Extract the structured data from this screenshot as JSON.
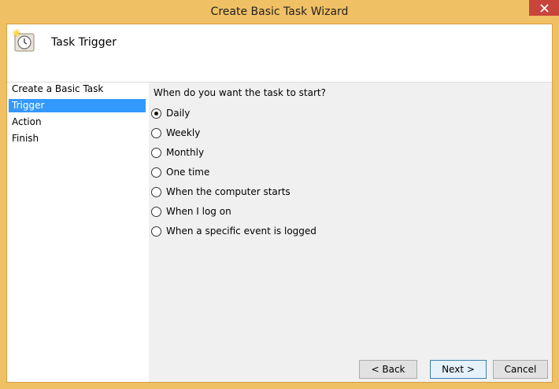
{
  "window": {
    "title": "Create Basic Task Wizard",
    "close_icon": "close-icon"
  },
  "header": {
    "icon": "clock-icon",
    "title": "Task Trigger"
  },
  "sidebar": {
    "items": [
      {
        "label": "Create a Basic Task",
        "selected": false
      },
      {
        "label": "Trigger",
        "selected": true
      },
      {
        "label": "Action",
        "selected": false
      },
      {
        "label": "Finish",
        "selected": false
      }
    ]
  },
  "main": {
    "question": "When do you want the task to start?",
    "options": [
      {
        "label": "Daily",
        "checked": true
      },
      {
        "label": "Weekly",
        "checked": false
      },
      {
        "label": "Monthly",
        "checked": false
      },
      {
        "label": "One time",
        "checked": false
      },
      {
        "label": "When the computer starts",
        "checked": false
      },
      {
        "label": "When I log on",
        "checked": false
      },
      {
        "label": "When a specific event is logged",
        "checked": false
      }
    ]
  },
  "footer": {
    "back_label": "< Back",
    "next_label": "Next >",
    "cancel_label": "Cancel"
  },
  "colors": {
    "title_bar": "#f0c064",
    "close_button": "#c7453a",
    "selection": "#3399ff"
  }
}
